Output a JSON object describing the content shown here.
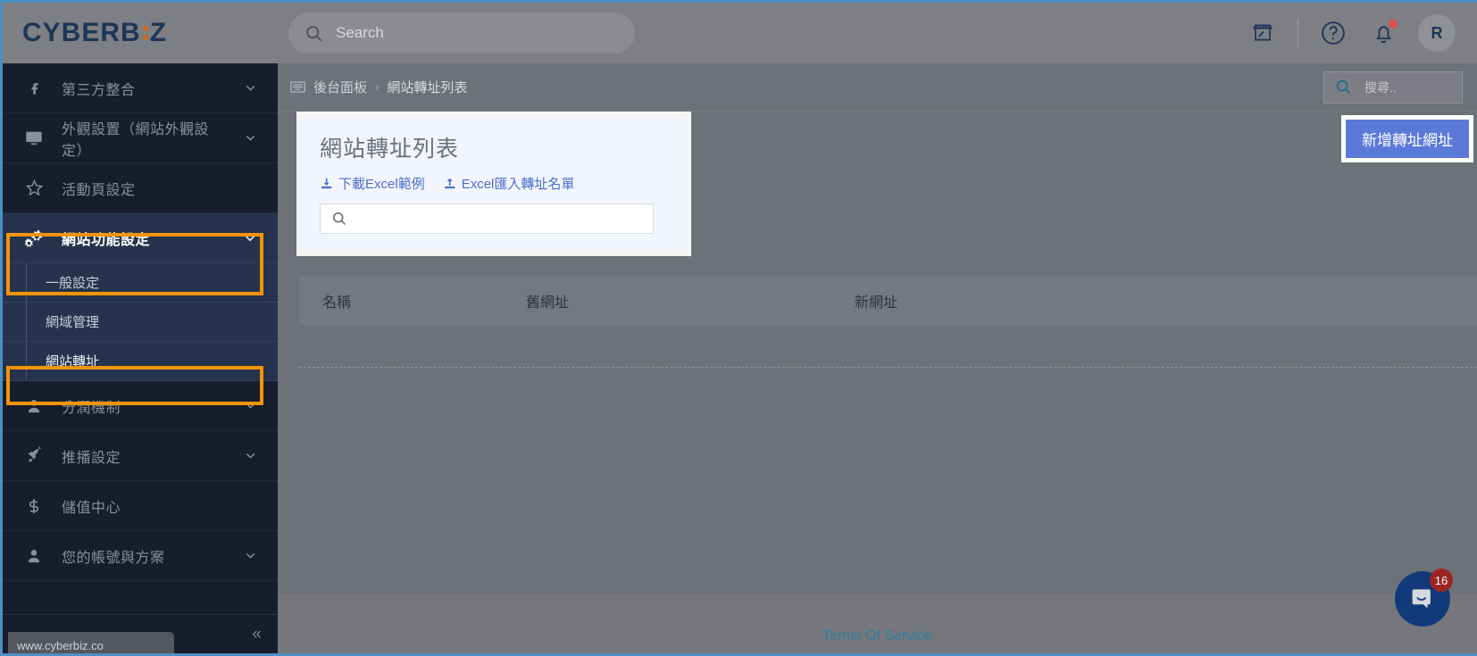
{
  "topbar": {
    "logo_text": "CYBERB",
    "logo_text_tail": "Z",
    "search_placeholder": "Search",
    "search_icon": "search-icon",
    "shop_icon": "storefront-icon",
    "help_icon": "help-circle-icon",
    "bell_icon": "bell-icon",
    "avatar_initial": "R"
  },
  "sidebar": {
    "items": [
      {
        "label": "第三方整合",
        "icon": "facebook-icon",
        "chevron": true,
        "state": "collapsed"
      },
      {
        "label": "外觀設置（網站外觀設定）",
        "icon": "monitor-icon",
        "chevron": true,
        "state": "collapsed"
      },
      {
        "label": "活動頁設定",
        "icon": "star-icon",
        "chevron": false,
        "state": "collapsed"
      },
      {
        "label": "網站功能設定",
        "icon": "gears-icon",
        "chevron": true,
        "state": "expanded"
      }
    ],
    "sub_items": [
      {
        "label": "一般設定",
        "current": false
      },
      {
        "label": "網域管理",
        "current": false
      },
      {
        "label": "網站轉址",
        "current": true
      }
    ],
    "items_after": [
      {
        "label": "分潤機制",
        "icon": "user-icon",
        "chevron": true,
        "state": "collapsed"
      },
      {
        "label": "推播設定",
        "icon": "rocket-icon",
        "chevron": true,
        "state": "collapsed"
      },
      {
        "label": "儲值中心",
        "icon": "dollar-icon",
        "chevron": false,
        "state": "collapsed"
      },
      {
        "label": "您的帳號與方案",
        "icon": "user-icon",
        "chevron": true,
        "state": "collapsed"
      }
    ],
    "collapse_icon": "double-chevron-left-icon",
    "status_url": "www.cyberbiz.co",
    "highlight_color": "#f5930a"
  },
  "content": {
    "breadcrumb": {
      "home_icon": "dashboard-icon",
      "home_label": "後台面板",
      "separator": "›",
      "current_label": "網站轉址列表"
    },
    "header_search": {
      "placeholder": "搜尋..",
      "value": "",
      "icon": "search-icon",
      "icon_color": "#1f6f84"
    },
    "card": {
      "title": "網站轉址列表",
      "links": [
        {
          "label": "下載Excel範例",
          "icon": "download-icon"
        },
        {
          "label": "Excel匯入轉址名單",
          "icon": "upload-icon"
        }
      ],
      "search": {
        "value": "",
        "placeholder": "",
        "icon": "search-icon"
      }
    },
    "add_button": {
      "label": "新增轉址網址",
      "color": "#5b79d9"
    },
    "table": {
      "columns": [
        "名稱",
        "舊網址",
        "新網址"
      ],
      "rows": []
    },
    "footer": {
      "terms_label": "Terms Of Service",
      "terms_color": "#2f7f9e"
    }
  },
  "intercom": {
    "icon": "chat-bubble-icon",
    "unread_count": "16",
    "badge_color": "#9b2523",
    "bubble_color": "#123a7a"
  }
}
